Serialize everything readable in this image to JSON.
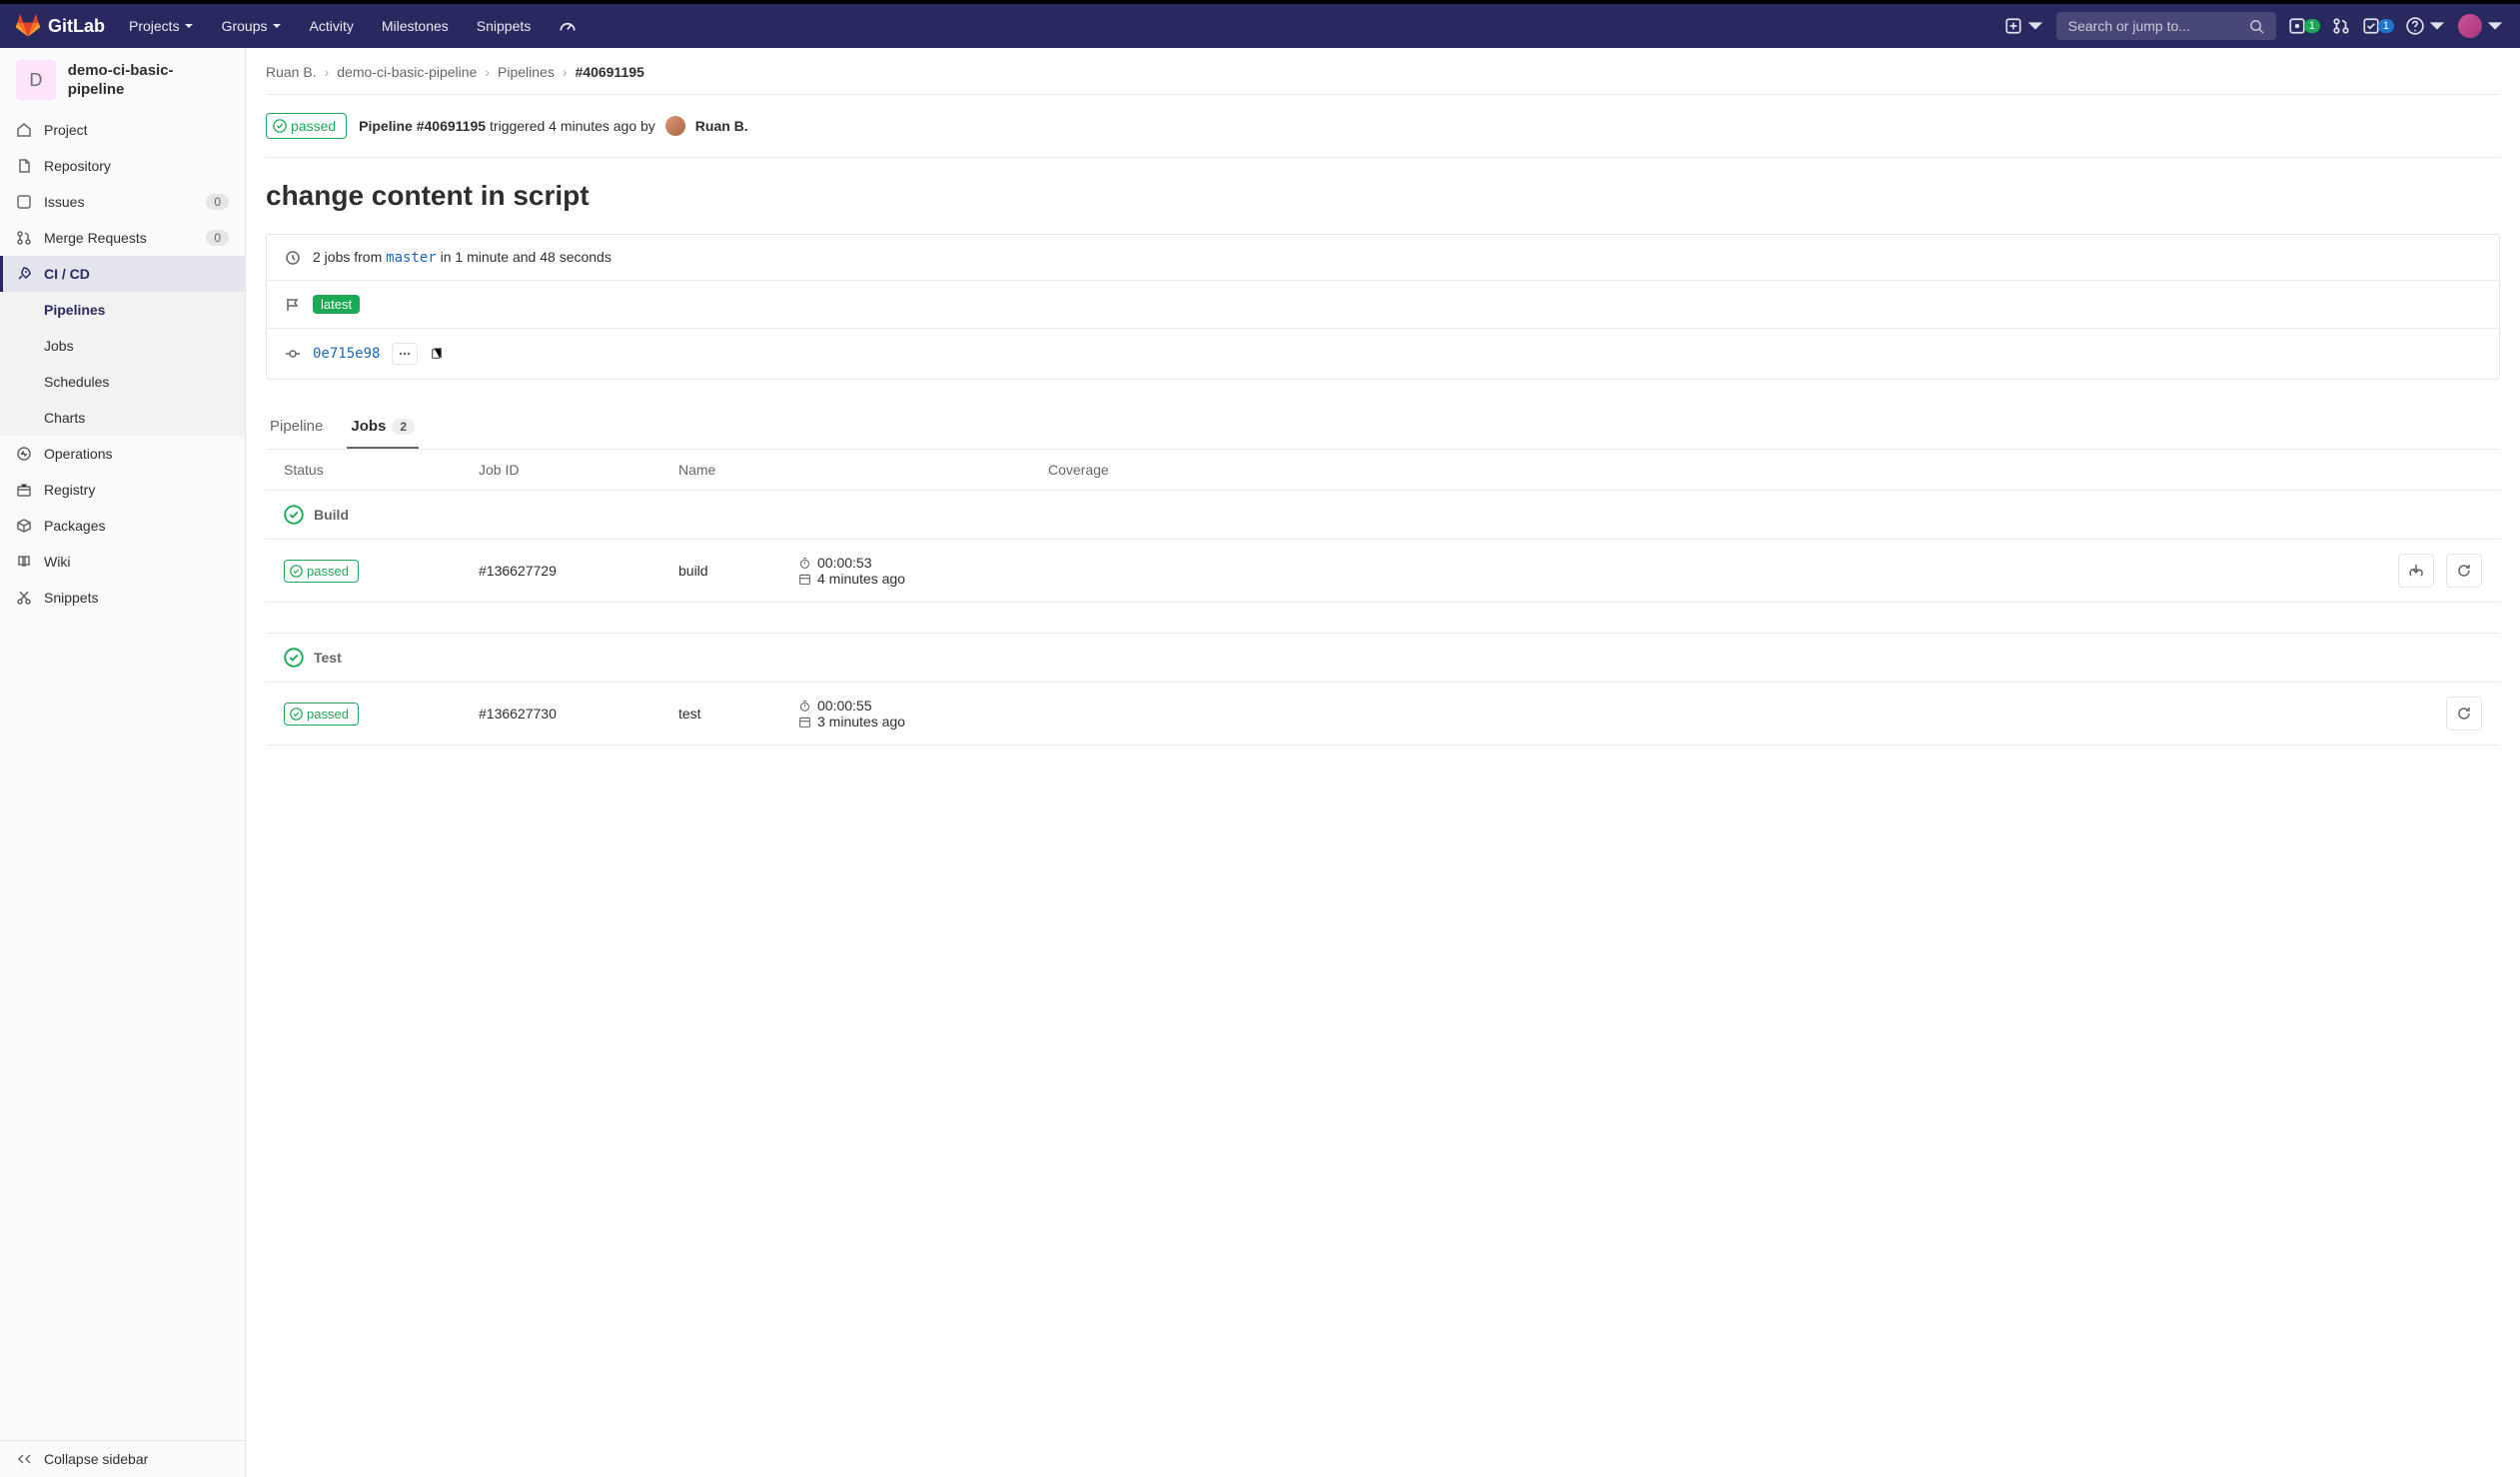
{
  "navbar": {
    "brand": "GitLab",
    "menu": [
      "Projects",
      "Groups",
      "Activity",
      "Milestones",
      "Snippets"
    ],
    "search_placeholder": "Search or jump to...",
    "issues_count": "1",
    "todos_count": "1"
  },
  "sidebar": {
    "project_initial": "D",
    "project_name": "demo-ci-basic-pipeline",
    "items": [
      {
        "label": "Project",
        "icon": "home"
      },
      {
        "label": "Repository",
        "icon": "file"
      },
      {
        "label": "Issues",
        "icon": "issues",
        "badge": "0"
      },
      {
        "label": "Merge Requests",
        "icon": "mr",
        "badge": "0"
      },
      {
        "label": "CI / CD",
        "icon": "rocket",
        "active": true,
        "sub": [
          {
            "label": "Pipelines",
            "active": true
          },
          {
            "label": "Jobs"
          },
          {
            "label": "Schedules"
          },
          {
            "label": "Charts"
          }
        ]
      },
      {
        "label": "Operations",
        "icon": "operations"
      },
      {
        "label": "Registry",
        "icon": "registry"
      },
      {
        "label": "Packages",
        "icon": "package"
      },
      {
        "label": "Wiki",
        "icon": "wiki"
      },
      {
        "label": "Snippets",
        "icon": "snippets"
      }
    ],
    "collapse": "Collapse sidebar"
  },
  "breadcrumb": {
    "parts": [
      "Ruan B.",
      "demo-ci-basic-pipeline",
      "Pipelines"
    ],
    "current": "#40691195"
  },
  "pipeline": {
    "status": "passed",
    "id_label": "Pipeline #40691195",
    "triggered": "triggered 4 minutes ago by",
    "user": "Ruan B.",
    "title": "change content in script",
    "branch": "master",
    "jobs_prefix": "2 jobs from",
    "jobs_suffix": "in 1 minute and 48 seconds",
    "label": "latest",
    "sha": "0e715e98"
  },
  "tabs": {
    "pipeline": "Pipeline",
    "jobs": "Jobs",
    "jobs_count": "2"
  },
  "table": {
    "headers": {
      "status": "Status",
      "jobid": "Job ID",
      "name": "Name",
      "coverage": "Coverage"
    },
    "stages": [
      {
        "name": "Build",
        "jobs": [
          {
            "status": "passed",
            "id": "#136627729",
            "name": "build",
            "duration": "00:00:53",
            "finished": "4 minutes ago",
            "download": true
          }
        ]
      },
      {
        "name": "Test",
        "jobs": [
          {
            "status": "passed",
            "id": "#136627730",
            "name": "test",
            "duration": "00:00:55",
            "finished": "3 minutes ago",
            "download": false
          }
        ]
      }
    ]
  }
}
